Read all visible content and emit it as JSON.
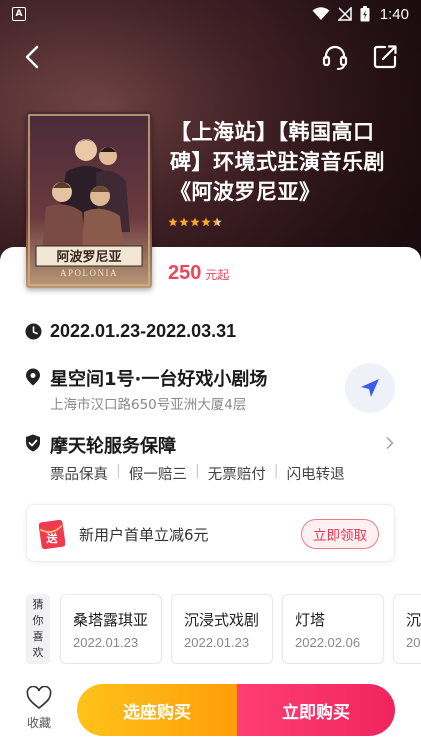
{
  "status_bar": {
    "time": "1:40",
    "left_icon": "a-square-icon"
  },
  "nav": {
    "back_icon": "chevron-left-icon",
    "service_icon": "headset-icon",
    "share_icon": "share-edit-icon"
  },
  "show": {
    "title": "【上海站】【韩国高口碑】环境式驻演音乐剧《阿波罗尼亚》",
    "rating_stars": 4.5,
    "price": "250",
    "price_unit": "元起",
    "poster_title_cn": "阿波罗尼亚",
    "poster_title_en": "APOLONIA"
  },
  "date": {
    "text": "2022.01.23-2022.03.31",
    "icon": "clock-icon"
  },
  "venue": {
    "name": "星空间1号·一台好戏小剧场",
    "address": "上海市汉口路650号亚洲大厦4层",
    "icon": "location-pin-icon",
    "nav_icon": "navigation-arrow-icon"
  },
  "guarantee": {
    "title": "摩天轮服务保障",
    "items": [
      "票品保真",
      "假一赔三",
      "无票赔付",
      "闪电转退"
    ],
    "icon": "shield-check-icon"
  },
  "coupon": {
    "icon_text": "送",
    "text": "新用户首单立减6元",
    "button": "立即领取"
  },
  "guess": {
    "label": [
      "猜",
      "你",
      "喜",
      "欢"
    ],
    "items": [
      {
        "name": "桑塔露琪亚",
        "date": "2022.01.23"
      },
      {
        "name": "沉浸式戏剧",
        "date": "2022.01.23"
      },
      {
        "name": "灯塔",
        "date": "2022.02.06"
      },
      {
        "name": "沉",
        "date": "20"
      }
    ]
  },
  "bottom": {
    "fav_label": "收藏",
    "seat_button": "选座购买",
    "buy_button": "立即购买"
  },
  "colors": {
    "accent_red": "#f0445d",
    "seat_orange": "#ffb012",
    "buy_pink": "#f0245e"
  }
}
